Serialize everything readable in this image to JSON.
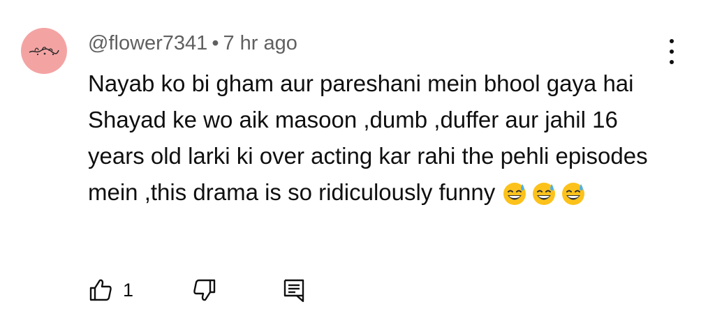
{
  "comment": {
    "author": "@flower7341",
    "separator": "•",
    "time": "7 hr ago",
    "text": "Nayab ko bi gham aur pareshani mein bhool gaya hai Shayad ke wo aik masoon ,dumb ,duffer aur jahil 16 years old larki ki over acting kar rahi the pehli episodes mein ,this drama is so ridiculously funny",
    "emojis": [
      "grinning-face-with-sweat",
      "grinning-face-with-sweat",
      "grinning-face-with-sweat"
    ],
    "avatar_color": "#f4a3a3",
    "like_count": "1"
  },
  "icons": {
    "like": "thumbs-up-icon",
    "dislike": "thumbs-down-icon",
    "reply": "reply-comment-icon",
    "menu": "more-vertical-icon"
  }
}
